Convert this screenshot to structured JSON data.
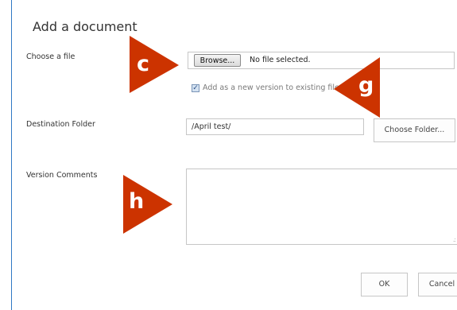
{
  "dialog": {
    "title": "Add a document",
    "close_glyph": "×"
  },
  "file": {
    "label": "Choose a file",
    "browse_label": "Browse...",
    "status": "No file selected.",
    "add_version_label": "Add as a new version to existing files",
    "add_version_checked": true
  },
  "destination": {
    "label": "Destination Folder",
    "value": "/April test/",
    "choose_label": "Choose Folder..."
  },
  "comments": {
    "label": "Version Comments",
    "value": ""
  },
  "buttons": {
    "ok_label": "OK",
    "cancel_label": "Cancel"
  },
  "callouts": {
    "c": "c",
    "g": "g",
    "h": "h",
    "color": "#cc3300"
  },
  "colors": {
    "dialog_border": "#2f78c4",
    "field_border": "#c6c6c6"
  },
  "icons": {
    "close": "close-icon",
    "checkbox": "checkbox-checked-icon",
    "resize": "resize-grip-icon"
  }
}
